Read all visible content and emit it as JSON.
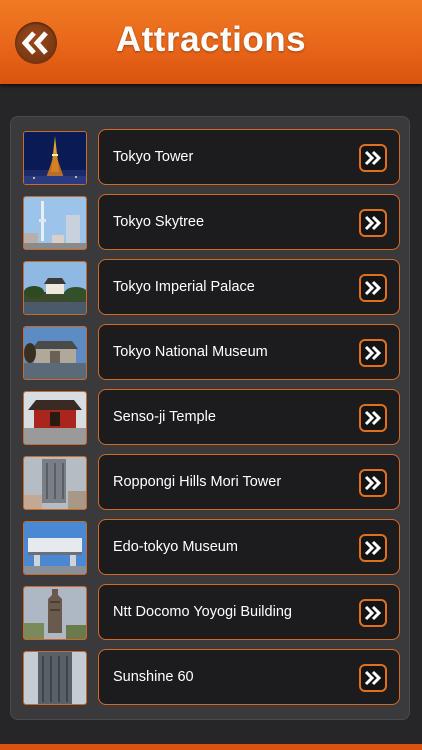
{
  "header": {
    "title": "Attractions",
    "back_icon": "double-chevron-left-icon",
    "color": "#e8661a"
  },
  "list": {
    "items": [
      {
        "label": "Tokyo Tower",
        "thumb_icon": "tokyo-tower-photo"
      },
      {
        "label": "Tokyo Skytree",
        "thumb_icon": "tokyo-skytree-photo"
      },
      {
        "label": "Tokyo Imperial Palace",
        "thumb_icon": "imperial-palace-photo"
      },
      {
        "label": "Tokyo National Museum",
        "thumb_icon": "national-museum-photo"
      },
      {
        "label": "Senso-ji Temple",
        "thumb_icon": "sensoji-temple-photo"
      },
      {
        "label": "Roppongi Hills Mori Tower",
        "thumb_icon": "mori-tower-photo"
      },
      {
        "label": "Edo-tokyo Museum",
        "thumb_icon": "edo-tokyo-museum-photo"
      },
      {
        "label": "Ntt Docomo Yoyogi Building",
        "thumb_icon": "docomo-building-photo"
      },
      {
        "label": "Sunshine 60",
        "thumb_icon": "sunshine-60-photo"
      }
    ],
    "arrow_icon": "double-chevron-right-icon",
    "accent": "#d46a22"
  }
}
